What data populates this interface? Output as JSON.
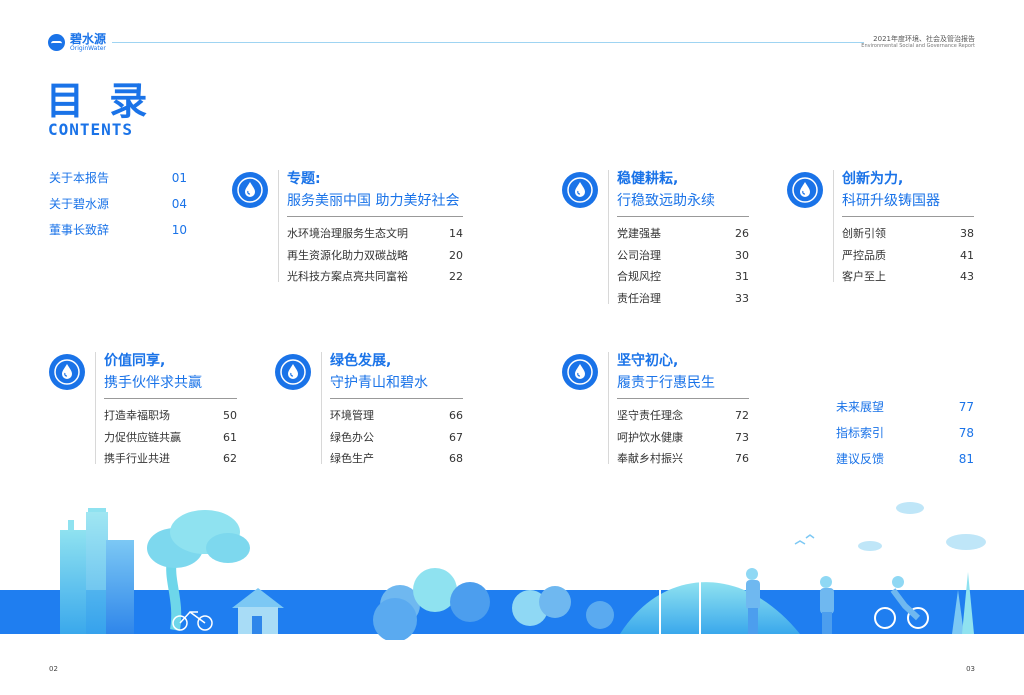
{
  "header": {
    "logo_cn": "碧水源",
    "logo_en": "OriginWater",
    "report_title_cn": "2021年度环境、社会及管治报告",
    "report_title_en": "Environmental Social and Governance Report"
  },
  "title": {
    "cn": "目 录",
    "en": "CONTENTS"
  },
  "intro_list": [
    {
      "label": "关于本报告",
      "page": "01"
    },
    {
      "label": "关于碧水源",
      "page": "04"
    },
    {
      "label": "董事长致辞",
      "page": "10"
    }
  ],
  "sections": [
    {
      "heading": "专题:",
      "subheading": "服务美丽中国 助力美好社会",
      "items": [
        {
          "label": "水环境治理服务生态文明",
          "page": "14"
        },
        {
          "label": "再生资源化助力双碳战略",
          "page": "20"
        },
        {
          "label": "光科技方案点亮共同富裕",
          "page": "22"
        }
      ]
    },
    {
      "heading": "稳健耕耘,",
      "subheading": "行稳致远助永续",
      "items": [
        {
          "label": "党建强基",
          "page": "26"
        },
        {
          "label": "公司治理",
          "page": "30"
        },
        {
          "label": "合规风控",
          "page": "31"
        },
        {
          "label": "责任治理",
          "page": "33"
        }
      ]
    },
    {
      "heading": "创新为力,",
      "subheading": "科研升级铸国器",
      "items": [
        {
          "label": "创新引领",
          "page": "38"
        },
        {
          "label": "严控品质",
          "page": "41"
        },
        {
          "label": "客户至上",
          "page": "43"
        }
      ]
    },
    {
      "heading": "价值同享,",
      "subheading": "携手伙伴求共赢",
      "items": [
        {
          "label": "打造幸福职场",
          "page": "50"
        },
        {
          "label": "力促供应链共赢",
          "page": "61"
        },
        {
          "label": "携手行业共进",
          "page": "62"
        }
      ]
    },
    {
      "heading": "绿色发展,",
      "subheading": "守护青山和碧水",
      "items": [
        {
          "label": "环境管理",
          "page": "66"
        },
        {
          "label": "绿色办公",
          "page": "67"
        },
        {
          "label": "绿色生产",
          "page": "68"
        }
      ]
    },
    {
      "heading": "坚守初心,",
      "subheading": "履责于行惠民生",
      "items": [
        {
          "label": "坚守责任理念",
          "page": "72"
        },
        {
          "label": "呵护饮水健康",
          "page": "73"
        },
        {
          "label": "奉献乡村振兴",
          "page": "76"
        }
      ]
    }
  ],
  "outro_list": [
    {
      "label": "未来展望",
      "page": "77"
    },
    {
      "label": "指标索引",
      "page": "78"
    },
    {
      "label": "建议反馈",
      "page": "81"
    }
  ],
  "footer": {
    "page_left": "02",
    "page_right": "03"
  },
  "colors": {
    "brand_blue": "#1a73e8",
    "light_cyan": "#7dd8ee",
    "band_blue": "#1f7ef0"
  }
}
